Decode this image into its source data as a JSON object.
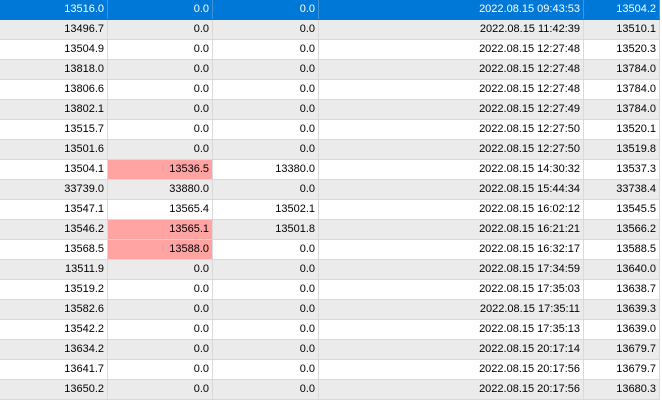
{
  "highlight_color": "#ffa3a3",
  "selected_color": "#0078d7",
  "rows": [
    {
      "cells": [
        "13516.0",
        "0.0",
        "0.0",
        "2022.08.15 09:43:53",
        "13504.2"
      ],
      "selected": true,
      "highlight": []
    },
    {
      "cells": [
        "13496.7",
        "0.0",
        "0.0",
        "2022.08.15 11:42:39",
        "13510.1"
      ],
      "selected": false,
      "highlight": []
    },
    {
      "cells": [
        "13504.9",
        "0.0",
        "0.0",
        "2022.08.15 12:27:48",
        "13520.3"
      ],
      "selected": false,
      "highlight": []
    },
    {
      "cells": [
        "13818.0",
        "0.0",
        "0.0",
        "2022.08.15 12:27:48",
        "13784.0"
      ],
      "selected": false,
      "highlight": []
    },
    {
      "cells": [
        "13806.6",
        "0.0",
        "0.0",
        "2022.08.15 12:27:48",
        "13784.0"
      ],
      "selected": false,
      "highlight": []
    },
    {
      "cells": [
        "13802.1",
        "0.0",
        "0.0",
        "2022.08.15 12:27:49",
        "13784.0"
      ],
      "selected": false,
      "highlight": []
    },
    {
      "cells": [
        "13515.7",
        "0.0",
        "0.0",
        "2022.08.15 12:27:50",
        "13520.1"
      ],
      "selected": false,
      "highlight": []
    },
    {
      "cells": [
        "13501.6",
        "0.0",
        "0.0",
        "2022.08.15 12:27:50",
        "13519.8"
      ],
      "selected": false,
      "highlight": []
    },
    {
      "cells": [
        "13504.1",
        "13536.5",
        "13380.0",
        "2022.08.15 14:30:32",
        "13537.3"
      ],
      "selected": false,
      "highlight": [
        1
      ]
    },
    {
      "cells": [
        "33739.0",
        "33880.0",
        "0.0",
        "2022.08.15 15:44:34",
        "33738.4"
      ],
      "selected": false,
      "highlight": []
    },
    {
      "cells": [
        "13547.1",
        "13565.4",
        "13502.1",
        "2022.08.15 16:02:12",
        "13545.5"
      ],
      "selected": false,
      "highlight": []
    },
    {
      "cells": [
        "13546.2",
        "13565.1",
        "13501.8",
        "2022.08.15 16:21:21",
        "13566.2"
      ],
      "selected": false,
      "highlight": [
        1
      ]
    },
    {
      "cells": [
        "13568.5",
        "13588.0",
        "0.0",
        "2022.08.15 16:32:17",
        "13588.5"
      ],
      "selected": false,
      "highlight": [
        1
      ]
    },
    {
      "cells": [
        "13511.9",
        "0.0",
        "0.0",
        "2022.08.15 17:34:59",
        "13640.0"
      ],
      "selected": false,
      "highlight": []
    },
    {
      "cells": [
        "13519.2",
        "0.0",
        "0.0",
        "2022.08.15 17:35:03",
        "13638.7"
      ],
      "selected": false,
      "highlight": []
    },
    {
      "cells": [
        "13582.6",
        "0.0",
        "0.0",
        "2022.08.15 17:35:11",
        "13639.3"
      ],
      "selected": false,
      "highlight": []
    },
    {
      "cells": [
        "13542.2",
        "0.0",
        "0.0",
        "2022.08.15 17:35:13",
        "13639.0"
      ],
      "selected": false,
      "highlight": []
    },
    {
      "cells": [
        "13634.2",
        "0.0",
        "0.0",
        "2022.08.15 20:17:14",
        "13679.7"
      ],
      "selected": false,
      "highlight": []
    },
    {
      "cells": [
        "13641.7",
        "0.0",
        "0.0",
        "2022.08.15 20:17:56",
        "13679.7"
      ],
      "selected": false,
      "highlight": []
    },
    {
      "cells": [
        "13650.2",
        "0.0",
        "0.0",
        "2022.08.15 20:17:56",
        "13680.3"
      ],
      "selected": false,
      "highlight": []
    }
  ]
}
